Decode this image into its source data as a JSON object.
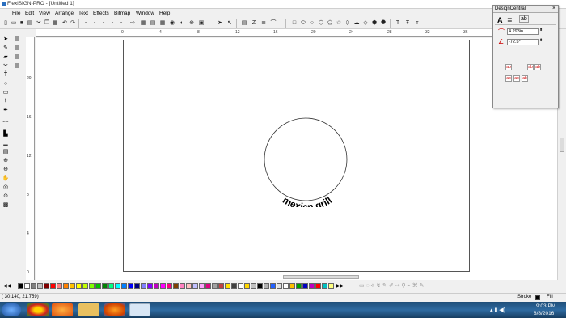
{
  "window": {
    "title": "FlexiSIGN-PRO - [Untitled 1]"
  },
  "menu": {
    "items": [
      "File",
      "Edit",
      "View",
      "Arrange",
      "Text",
      "Effects",
      "Bitmap",
      "Window",
      "Help"
    ]
  },
  "ruler": {
    "h_labels": [
      "0",
      "4",
      "8",
      "12",
      "16",
      "20",
      "24",
      "28",
      "32",
      "36"
    ],
    "v_labels": [
      "20",
      "16",
      "12",
      "8",
      "4",
      "0"
    ]
  },
  "canvas": {
    "arc_text": "mexicn grill"
  },
  "design_central": {
    "title": "DesignCentral",
    "radius_value": "4.293in",
    "angle_value": "-72.5°"
  },
  "status": {
    "coords": "(   30.140,   21.759)",
    "stroke_label": "Stroke",
    "fill_label": "Fill"
  },
  "taskbar": {
    "time": "9:03 PM",
    "date": "8/8/2016"
  },
  "colors": {
    "accent": "#2a6fbf",
    "taskbar": "#1f4e78"
  }
}
